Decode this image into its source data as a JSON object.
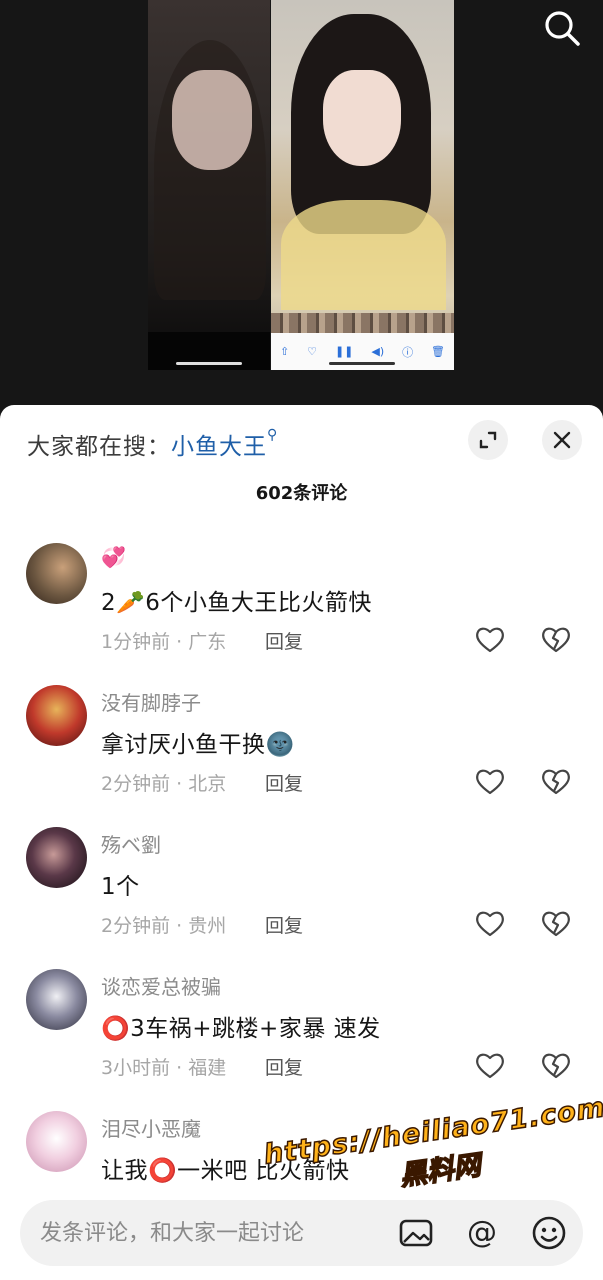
{
  "video": {
    "left_controls": [
      "share-icon",
      "heart-icon",
      "pause-icon",
      "volume-icon",
      "info-icon",
      "trash-icon"
    ]
  },
  "sheet": {
    "trending_prefix": "大家都在搜：",
    "trending_keyword": "小鱼大王",
    "comment_count": "602条评论",
    "input_placeholder": "发条评论，和大家一起讨论"
  },
  "comments": [
    {
      "username": "💞",
      "text": "2🥕6个小鱼大王比火箭快",
      "time": "1分钟前",
      "location": "广东",
      "reply": "回复",
      "avatar_color": "#6b5640"
    },
    {
      "username": "没有脚脖子",
      "text": "拿讨厌小鱼干换🌚",
      "time": "2分钟前",
      "location": "北京",
      "reply": "回复",
      "avatar_color": "#c0392b"
    },
    {
      "username": "殇ベ劉",
      "text": "1个",
      "time": "2分钟前",
      "location": "贵州",
      "reply": "回复",
      "avatar_color": "#2a1a24"
    },
    {
      "username": "谈恋爱总被骗",
      "text": "⭕3车祸+跳楼+家暴 速发",
      "time": "3小时前",
      "location": "福建",
      "reply": "回复",
      "avatar_color": "#4a4a58"
    },
    {
      "username": "泪尽小恶魔",
      "text": "让我⭕一米吧 比火箭快",
      "time": "",
      "location": "",
      "reply": "",
      "avatar_color": "#e8c8d8"
    }
  ],
  "watermark": {
    "url": "https://heiliao71.com",
    "cn": "黑料网"
  },
  "colors": {
    "keyword": "#1f5fa8",
    "meta": "#a6a6a6",
    "background_dark": "#161616"
  }
}
